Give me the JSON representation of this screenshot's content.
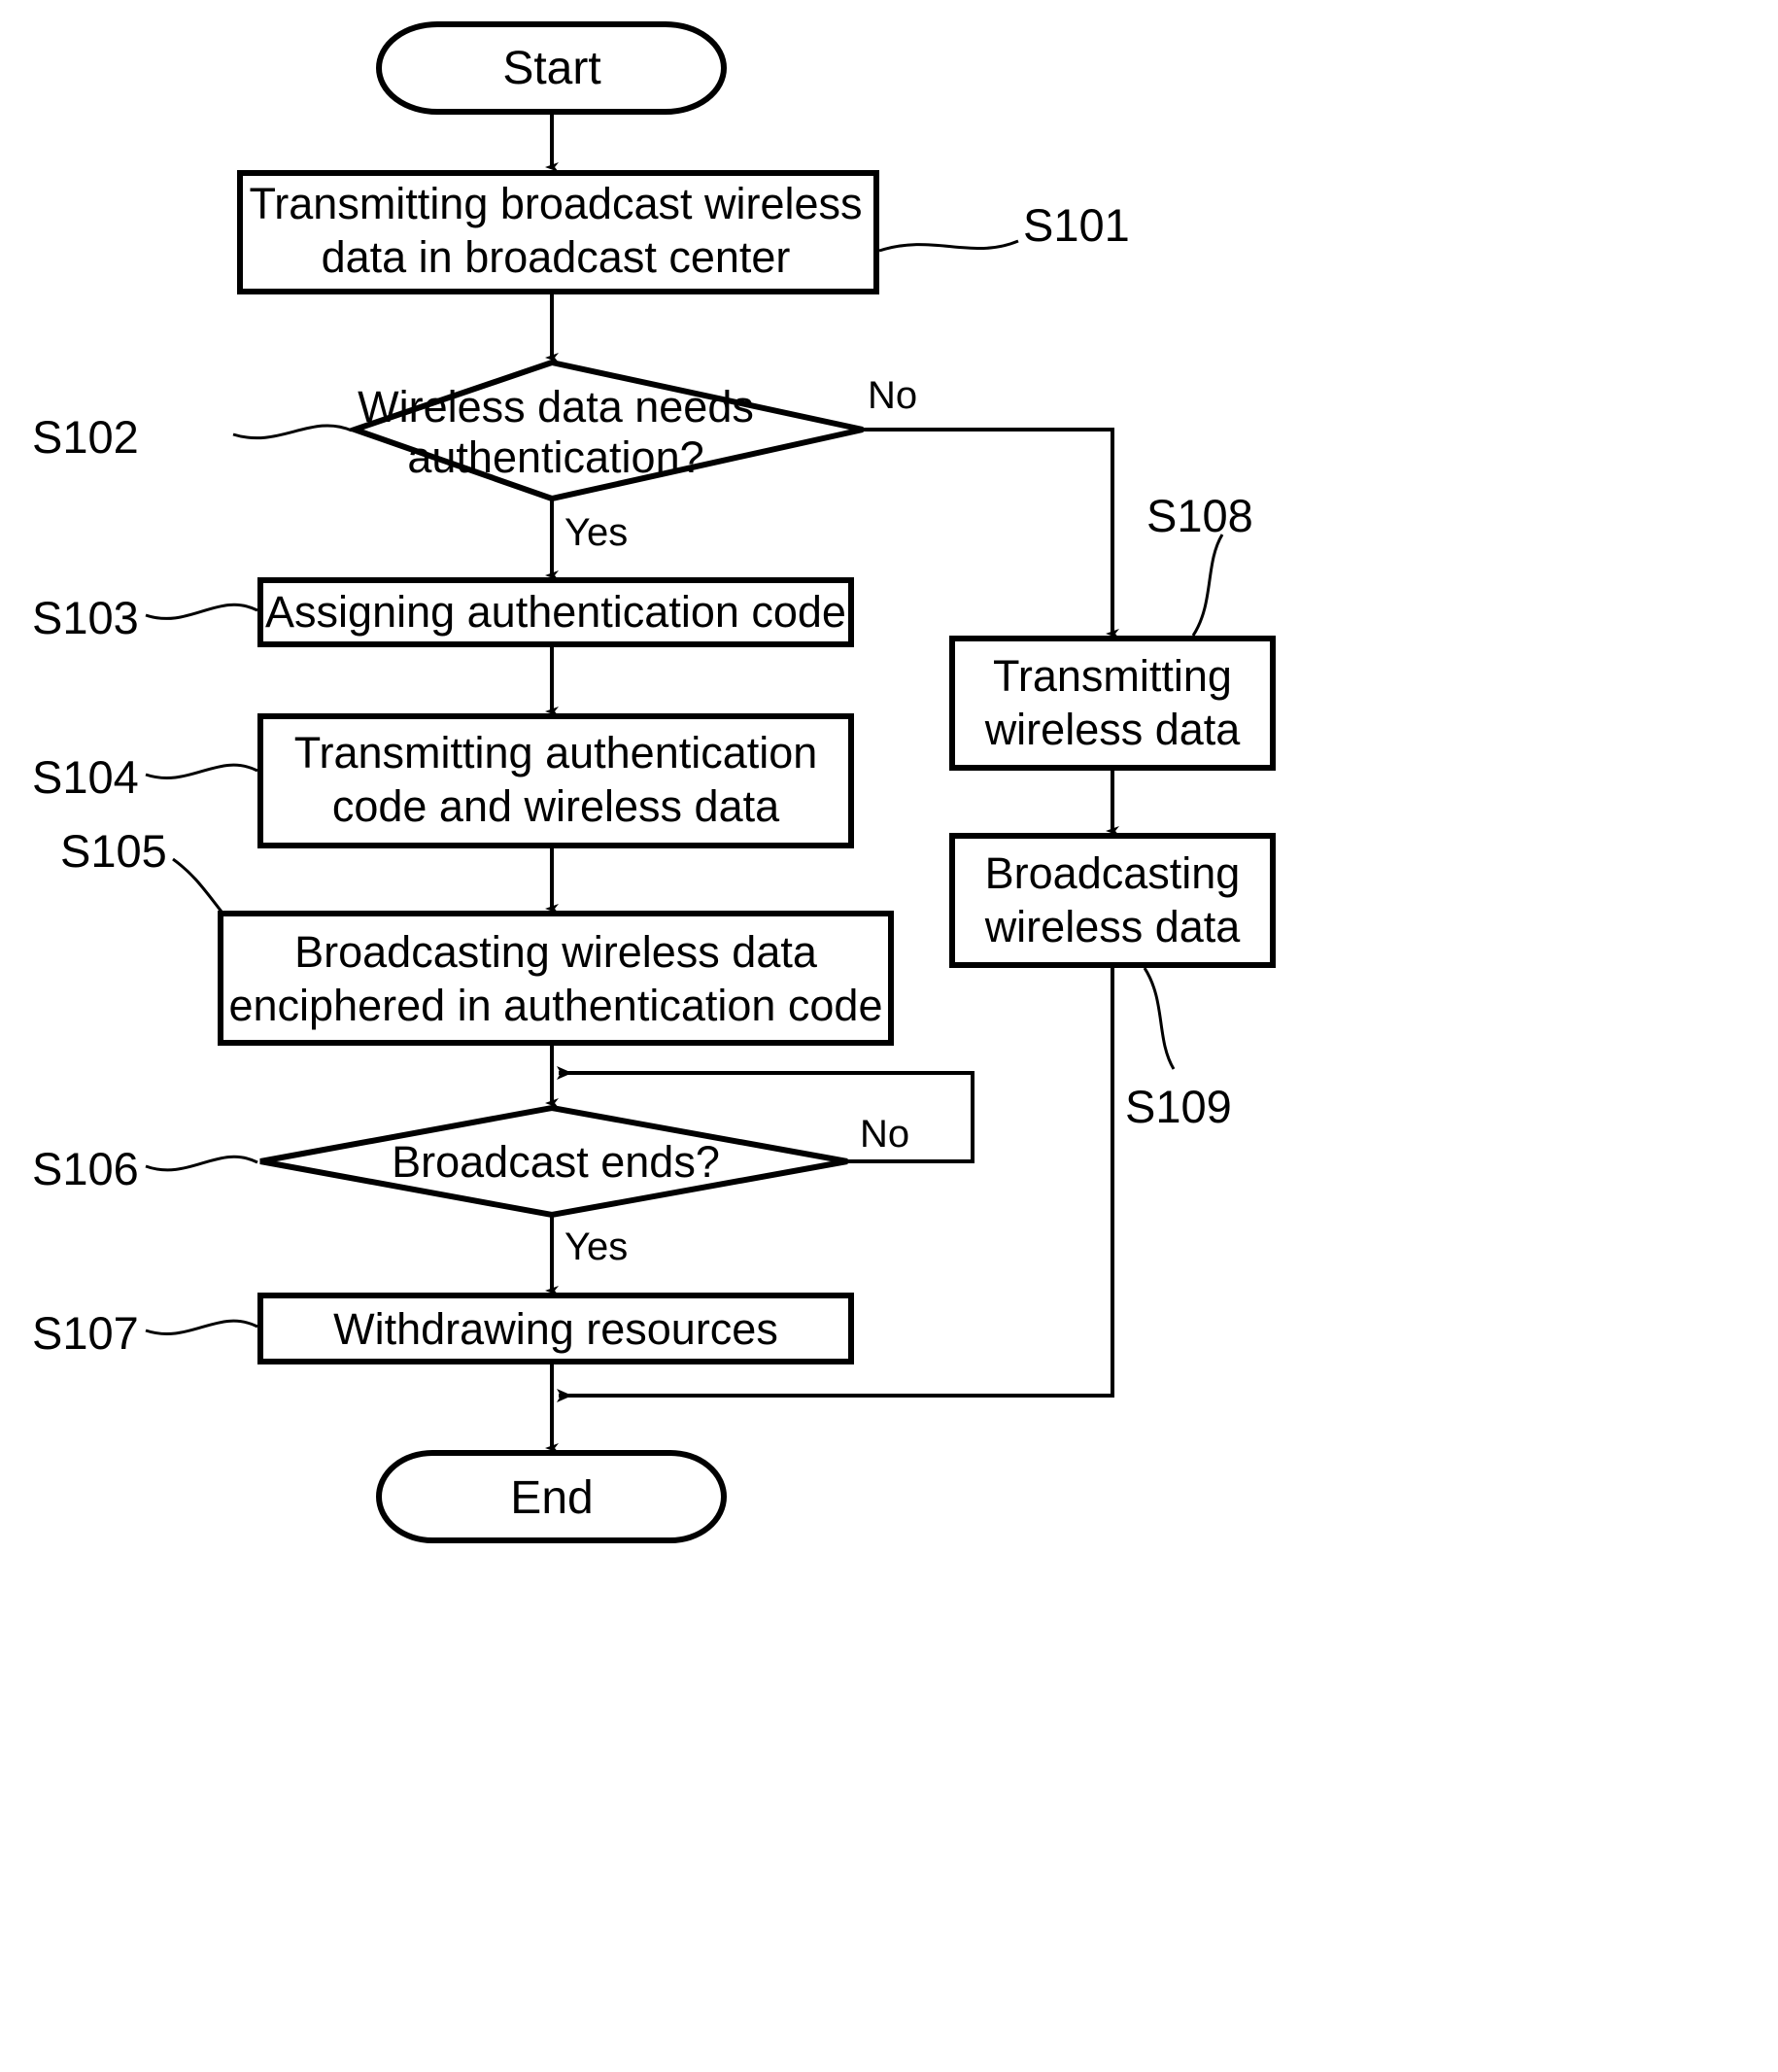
{
  "diagram": {
    "title": "Wireless broadcast authentication flowchart",
    "type": "flowchart",
    "background_color": "#ffffff",
    "line_color": "#000000"
  },
  "nodes": {
    "start": {
      "id": "start",
      "shape": "terminator",
      "label": "Start"
    },
    "s101": {
      "id": "S101",
      "shape": "process",
      "ref": "S101",
      "line1": "Transmitting broadcast wireless",
      "line2": "data in broadcast center"
    },
    "s102": {
      "id": "S102",
      "shape": "decision",
      "ref": "S102",
      "line1": "Wireless data needs",
      "line2": "authentication?"
    },
    "s103": {
      "id": "S103",
      "shape": "process",
      "ref": "S103",
      "line1": "Assigning authentication code"
    },
    "s104": {
      "id": "S104",
      "shape": "process",
      "ref": "S104",
      "line1": "Transmitting authentication",
      "line2": "code and wireless data"
    },
    "s105": {
      "id": "S105",
      "shape": "process",
      "ref": "S105",
      "line1": "Broadcasting wireless data",
      "line2": "enciphered in authentication code"
    },
    "s106": {
      "id": "S106",
      "shape": "decision",
      "ref": "S106",
      "line1": "Broadcast ends?"
    },
    "s107": {
      "id": "S107",
      "shape": "process",
      "ref": "S107",
      "line1": "Withdrawing resources"
    },
    "s108": {
      "id": "S108",
      "shape": "process",
      "ref": "S108",
      "line1": "Transmitting",
      "line2": "wireless data"
    },
    "s109": {
      "id": "S109",
      "shape": "process",
      "ref": "S109",
      "line1": "Broadcasting",
      "line2": "wireless data"
    },
    "end": {
      "id": "end",
      "shape": "terminator",
      "label": "End"
    }
  },
  "edge_labels": {
    "s102_no": "No",
    "s102_yes": "Yes",
    "s106_no": "No",
    "s106_yes": "Yes"
  }
}
